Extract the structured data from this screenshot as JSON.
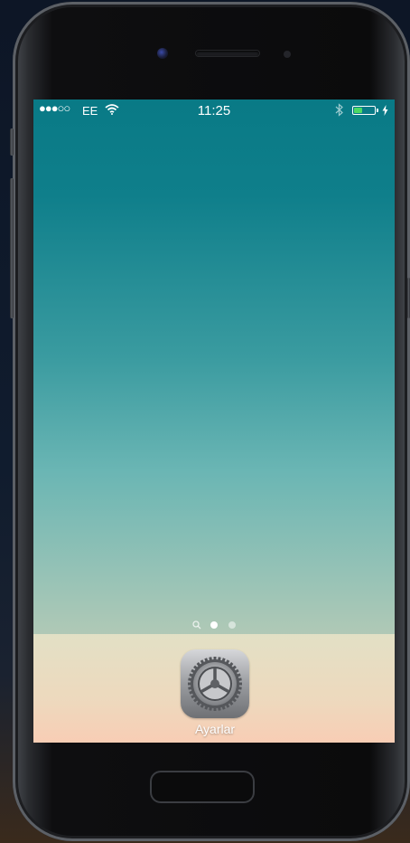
{
  "status_bar": {
    "signal": "●●●○○",
    "carrier": "EE",
    "time": "11:25",
    "battery_level": 0.4,
    "icons": [
      "wifi-icon",
      "bluetooth-icon",
      "battery-icon",
      "charging-bolt-icon"
    ]
  },
  "page_indicator": {
    "pages": 2,
    "current_page": 1,
    "search_icon": "search-icon"
  },
  "dock": {
    "apps": [
      {
        "label": "Ayarlar",
        "icon": "settings-gear-icon"
      }
    ]
  },
  "colors": {
    "wallpaper_top": "#097a86",
    "wallpaper_bottom": "#d8d3be",
    "battery_fill": "#4cd964"
  }
}
